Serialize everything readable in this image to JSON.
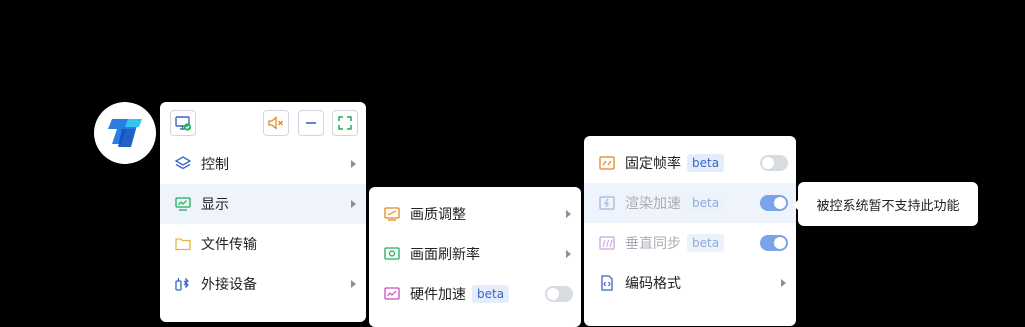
{
  "colors": {
    "accent": "#3a66c4",
    "toggle_on": "#5b8de6",
    "toggle_off": "#d8dbe1",
    "warning": "#e08a1e",
    "success": "#1dae5a"
  },
  "main_menu": {
    "toolbar_icons": [
      "remote-screen-icon",
      "mute-icon",
      "minimize-icon",
      "fullscreen-icon"
    ],
    "items": [
      {
        "label": "控制",
        "icon": "layers-icon",
        "has_submenu": true,
        "active": false
      },
      {
        "label": "显示",
        "icon": "monitor-chart-icon",
        "has_submenu": true,
        "active": true
      },
      {
        "label": "文件传输",
        "icon": "folder-icon",
        "has_submenu": false,
        "active": false
      },
      {
        "label": "外接设备",
        "icon": "usb-bluetooth-icon",
        "has_submenu": true,
        "active": false
      }
    ]
  },
  "display_submenu": {
    "items": [
      {
        "label": "画质调整",
        "icon": "picture-quality-icon",
        "has_submenu": true
      },
      {
        "label": "画面刷新率",
        "icon": "refresh-screen-icon",
        "has_submenu": true
      },
      {
        "label": "硬件加速",
        "icon": "chart-screen-icon",
        "badge": "beta",
        "toggle": false
      }
    ]
  },
  "advanced_submenu": {
    "items": [
      {
        "label": "固定帧率",
        "icon": "fixed-framerate-icon",
        "badge": "beta",
        "toggle": false,
        "disabled": false
      },
      {
        "label": "渲染加速",
        "icon": "render-accel-icon",
        "badge": "beta",
        "toggle": true,
        "disabled": true
      },
      {
        "label": "垂直同步",
        "icon": "vsync-icon",
        "badge": "beta",
        "toggle": true,
        "disabled": true
      },
      {
        "label": "编码格式",
        "icon": "code-file-icon",
        "has_submenu": true,
        "disabled": false
      }
    ]
  },
  "tooltip": {
    "text": "被控系统暂不支持此功能"
  }
}
